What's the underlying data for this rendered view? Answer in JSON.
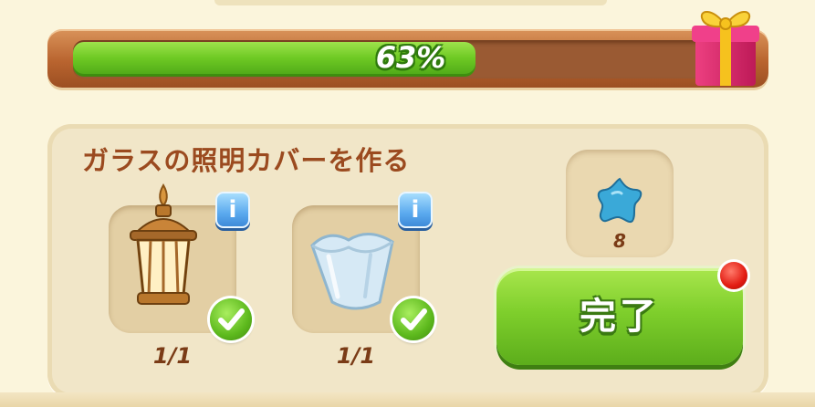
{
  "progress": {
    "percent_label": "63%",
    "value": 0.63
  },
  "task": {
    "title": "ガラスの照明カバーを作る"
  },
  "ingredients": [
    {
      "name": "lantern-icon",
      "count": "1/1",
      "info": "i"
    },
    {
      "name": "glass-cover-icon",
      "count": "1/1",
      "info": "i"
    }
  ],
  "reward": {
    "icon": "blue-star-icon",
    "count": "8"
  },
  "complete_button": {
    "label": "完了"
  },
  "colors": {
    "accent_green": "#7fcf2c",
    "title_brown": "#9b4a1f",
    "info_blue": "#3a86d6",
    "notify_red": "#e21b12"
  }
}
